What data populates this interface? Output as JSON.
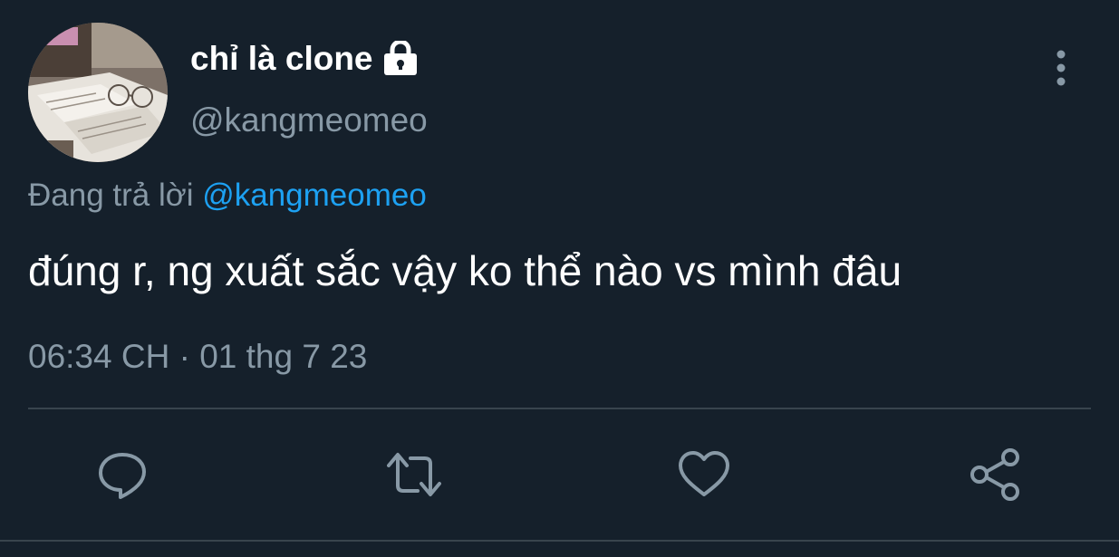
{
  "tweet": {
    "display_name": "chỉ là clone",
    "handle": "@kangmeomeo",
    "reply_prefix": "Đang trả lời ",
    "reply_to": "@kangmeomeo",
    "text": "đúng r, ng xuất sắc vậy ko thể nào vs mình đâu",
    "timestamp": "06:34 CH · 01 thg 7 23",
    "protected_icon": "lock-icon",
    "menu_icon": "more-vertical-icon"
  },
  "actions": [
    {
      "name": "reply",
      "icon": "comment-icon"
    },
    {
      "name": "retweet",
      "icon": "retweet-icon"
    },
    {
      "name": "like",
      "icon": "heart-icon"
    },
    {
      "name": "share",
      "icon": "share-icon"
    }
  ],
  "colors": {
    "background": "#15202b",
    "primary_text": "#ffffff",
    "secondary_text": "#8899a6",
    "link": "#1da1f2",
    "divider": "#38444d"
  }
}
